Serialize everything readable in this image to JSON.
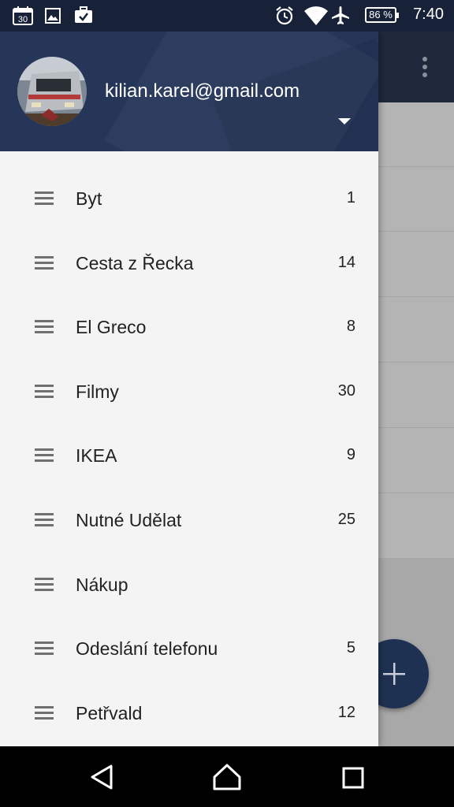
{
  "status_bar": {
    "calendar_day": "30",
    "battery": "86 %",
    "time": "7:40",
    "icons": [
      "calendar-icon",
      "image-icon",
      "briefcase-check-icon",
      "alarm-icon",
      "wifi-icon",
      "airplane-icon",
      "battery-icon"
    ]
  },
  "drawer": {
    "account_email": "kilian.karel@gmail.com",
    "items": [
      {
        "label": "Byt",
        "count": "1"
      },
      {
        "label": "Cesta z Řecka",
        "count": "14"
      },
      {
        "label": "El Greco",
        "count": "8"
      },
      {
        "label": "Filmy",
        "count": "30"
      },
      {
        "label": "IKEA",
        "count": "9"
      },
      {
        "label": "Nutné Udělat",
        "count": "25"
      },
      {
        "label": "Nákup",
        "count": ""
      },
      {
        "label": "Odeslání telefonu",
        "count": "5"
      },
      {
        "label": "Petřvald",
        "count": "12"
      }
    ]
  },
  "colors": {
    "header": "#253659",
    "status_bar": "#172238",
    "fab": "#1f3152",
    "drawer_bg": "#f4f4f4"
  }
}
